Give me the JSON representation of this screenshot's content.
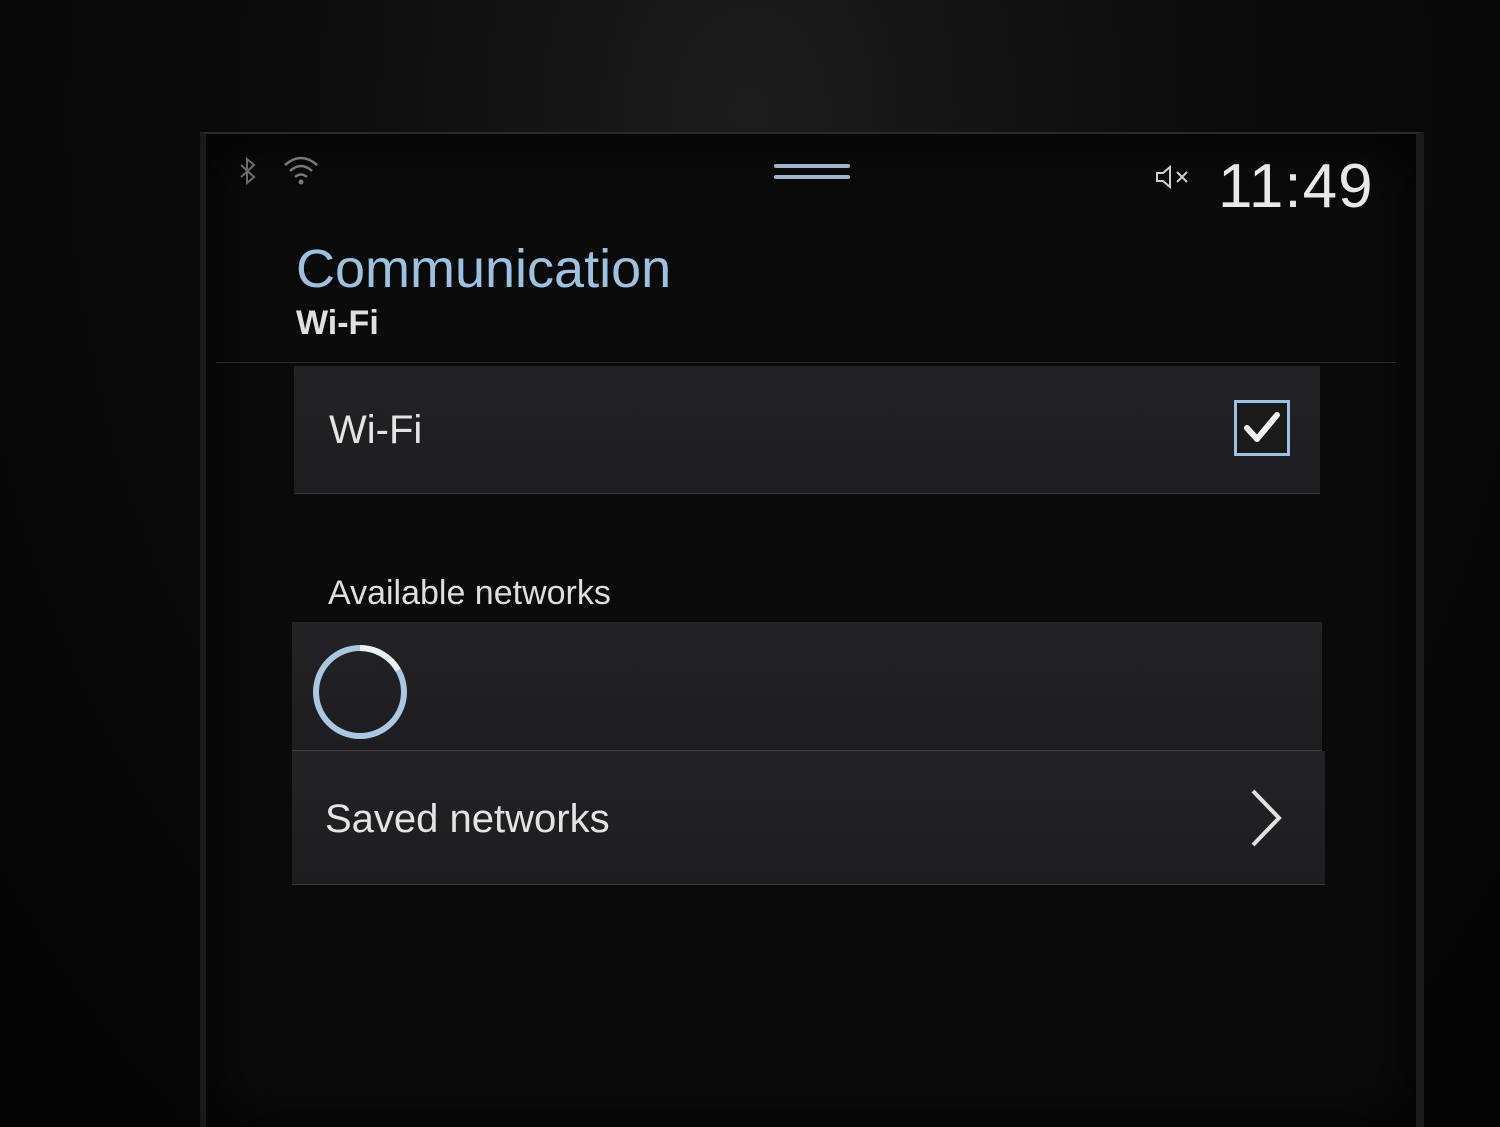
{
  "status_bar": {
    "bluetooth_icon": "bluetooth-icon",
    "wifi_icon": "wifi-signal-icon",
    "drag_handle_icon": "drag-handle-icon",
    "mute_icon": "volume-muted-icon",
    "time": "11:49"
  },
  "header": {
    "title": "Communication",
    "subtitle": "Wi-Fi"
  },
  "wifi_toggle": {
    "label": "Wi-Fi",
    "checked": true,
    "icon": "checkbox-checked-icon"
  },
  "available_networks": {
    "label": "Available networks",
    "loading_icon": "loading-spinner-icon"
  },
  "saved_networks": {
    "label": "Saved networks",
    "icon": "chevron-right-icon"
  },
  "colors": {
    "accent": "#9dc1e0",
    "background": "#0a0a0b",
    "row_background": "#202022",
    "text": "#e4e4e4"
  }
}
